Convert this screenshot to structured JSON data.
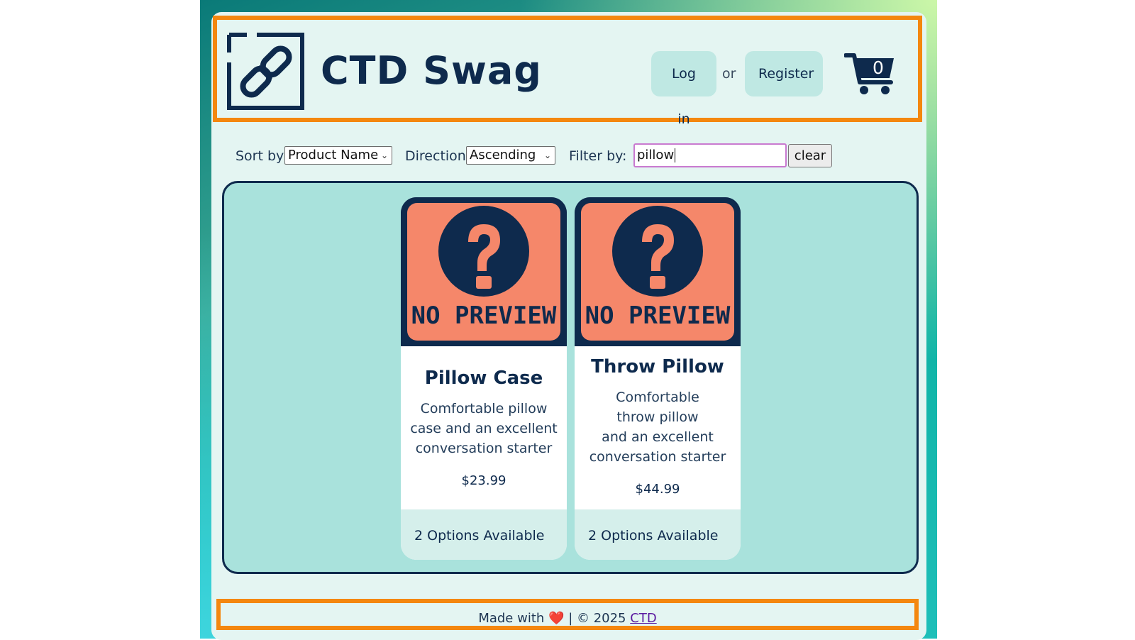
{
  "header": {
    "site_title": "CTD Swag",
    "login_label": "Log in",
    "or_text": "or",
    "register_label": "Register",
    "cart_count": "0",
    "logo_icon": "chain-link-icon",
    "cart_icon": "shopping-cart-icon"
  },
  "controls": {
    "sort_label": "Sort by:",
    "sort_value": "Product Name",
    "direction_label": "Direction:",
    "direction_value": "Ascending",
    "filter_label": "Filter by:",
    "filter_value": "pillow",
    "clear_label": "clear"
  },
  "products": [
    {
      "image_text": "NO PREVIEW",
      "name": "Pillow Case",
      "description_lines": [
        "Comfortable pillow",
        "case and an excellent",
        "conversation starter"
      ],
      "price": "$23.99",
      "options": "2 Options Available"
    },
    {
      "image_text": "NO PREVIEW",
      "name": "Throw Pillow",
      "description_lines": [
        "Comfortable",
        "throw pillow",
        "and an excellent",
        "conversation starter"
      ],
      "price": "$44.99",
      "options": "2 Options Available"
    }
  ],
  "footer": {
    "made_with": "Made with",
    "heart": "❤️",
    "copyright": "| © 2025",
    "link": "CTD"
  },
  "colors": {
    "navy": "#0e2a4d",
    "accent_orange": "#f4870f",
    "page_bg": "#e4f5f2",
    "products_bg": "#a9e2dc",
    "button_bg": "#bfe8e3",
    "preview_salmon": "#f5876a"
  }
}
